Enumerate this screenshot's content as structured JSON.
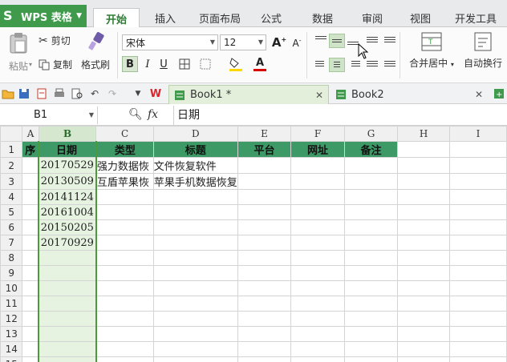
{
  "app": {
    "name": "WPS 表格"
  },
  "tabs": [
    {
      "label": "开始",
      "active": true
    },
    {
      "label": "插入"
    },
    {
      "label": "页面布局"
    },
    {
      "label": "公式"
    },
    {
      "label": "数据"
    },
    {
      "label": "审阅"
    },
    {
      "label": "视图"
    },
    {
      "label": "开发工具"
    }
  ],
  "ribbon": {
    "paste": "粘贴",
    "cut": "剪切",
    "copy": "复制",
    "format_painter": "格式刷",
    "font_name": "宋体",
    "font_size": "12",
    "bold": "B",
    "italic": "I",
    "underline": "U",
    "merge_center": "合并居中",
    "wrap_text": "自动换行",
    "font_color": "#d40000",
    "fill_color": "#ffd700",
    "accent": "#3f9a4b"
  },
  "documents": [
    {
      "name": "Book1 *",
      "active": true
    },
    {
      "name": "Book2",
      "active": false
    }
  ],
  "formula_bar": {
    "cell_ref": "B1",
    "fx": "fx",
    "value": "日期"
  },
  "sheet": {
    "columns": [
      "A",
      "B",
      "C",
      "D",
      "E",
      "F",
      "G",
      "H",
      "I"
    ],
    "selected_column": "B",
    "row_numbers": [
      "1",
      "2",
      "3",
      "4",
      "5",
      "6",
      "7",
      "8",
      "9",
      "10",
      "11",
      "12",
      "13",
      "14",
      "15"
    ],
    "header_row": [
      "序",
      "日期",
      "类型",
      "标题",
      "平台",
      "网址",
      "备注"
    ],
    "rows": [
      {
        "date": "20170529",
        "type": "强力数据恢",
        "title": "文件恢复软件"
      },
      {
        "date": "20130509",
        "type": "互盾苹果恢",
        "title": "苹果手机数据恢复"
      },
      {
        "date": "20141124",
        "type": "",
        "title": ""
      },
      {
        "date": "20161004",
        "type": "",
        "title": ""
      },
      {
        "date": "20150205",
        "type": "",
        "title": ""
      },
      {
        "date": "20170929",
        "type": "",
        "title": ""
      }
    ]
  }
}
